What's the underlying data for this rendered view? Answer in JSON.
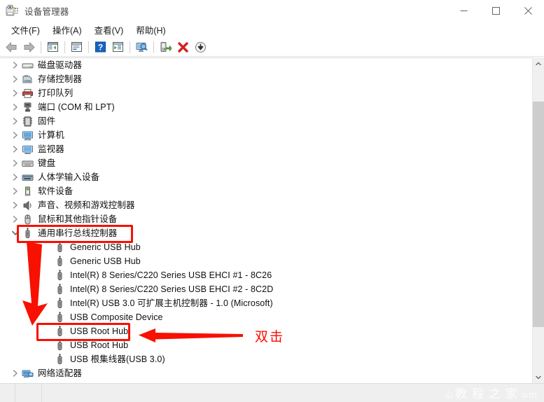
{
  "window": {
    "title": "设备管理器",
    "icon": "device-manager-icon",
    "controls": {
      "minimize": "最小化",
      "maximize": "最大化",
      "close": "关闭"
    }
  },
  "menubar": {
    "items": [
      {
        "label": "文件(F)",
        "name": "menu-file"
      },
      {
        "label": "操作(A)",
        "name": "menu-action"
      },
      {
        "label": "查看(V)",
        "name": "menu-view"
      },
      {
        "label": "帮助(H)",
        "name": "menu-help"
      }
    ]
  },
  "toolbar": {
    "buttons": [
      {
        "name": "back-button",
        "icon": "arrow-left-icon",
        "tooltip": "后退"
      },
      {
        "name": "forward-button",
        "icon": "arrow-right-icon",
        "tooltip": "前进"
      },
      {
        "name": "show-hide-console-tree-button",
        "icon": "console-tree-icon",
        "tooltip": "显示/隐藏控制台树"
      },
      {
        "name": "properties-button",
        "icon": "properties-icon",
        "tooltip": "属性"
      },
      {
        "name": "help-button",
        "icon": "help-question-icon",
        "tooltip": "帮助"
      },
      {
        "name": "update-driver-button",
        "icon": "update-driver-icon",
        "tooltip": "更新驱动程序"
      },
      {
        "name": "scan-hardware-changes-button",
        "icon": "scan-monitor-icon",
        "tooltip": "扫描检测硬件改动"
      },
      {
        "name": "enable-device-button",
        "icon": "enable-device-icon",
        "tooltip": "启用设备"
      },
      {
        "name": "uninstall-device-button",
        "icon": "red-x-icon",
        "tooltip": "卸载设备"
      },
      {
        "name": "disable-device-button",
        "icon": "disable-down-arrow-icon",
        "tooltip": "禁用设备"
      }
    ]
  },
  "tree": {
    "rows": [
      {
        "label": "磁盘驱动器",
        "level": 1,
        "expander": "collapsed",
        "icon": "disk-drive-icon",
        "name": "tree-item-disk-drives"
      },
      {
        "label": "存储控制器",
        "level": 1,
        "expander": "collapsed",
        "icon": "storage-controller-icon",
        "name": "tree-item-storage-controllers"
      },
      {
        "label": "打印队列",
        "level": 1,
        "expander": "collapsed",
        "icon": "printer-icon",
        "name": "tree-item-print-queues"
      },
      {
        "label": "端口 (COM 和 LPT)",
        "level": 1,
        "expander": "collapsed",
        "icon": "port-icon",
        "name": "tree-item-ports"
      },
      {
        "label": "固件",
        "level": 1,
        "expander": "collapsed",
        "icon": "firmware-chip-icon",
        "name": "tree-item-firmware"
      },
      {
        "label": "计算机",
        "level": 1,
        "expander": "collapsed",
        "icon": "computer-icon",
        "name": "tree-item-computer"
      },
      {
        "label": "监视器",
        "level": 1,
        "expander": "collapsed",
        "icon": "monitor-icon",
        "name": "tree-item-monitors"
      },
      {
        "label": "键盘",
        "level": 1,
        "expander": "collapsed",
        "icon": "keyboard-icon",
        "name": "tree-item-keyboards"
      },
      {
        "label": "人体学输入设备",
        "level": 1,
        "expander": "collapsed",
        "icon": "hid-icon",
        "name": "tree-item-hid"
      },
      {
        "label": "软件设备",
        "level": 1,
        "expander": "collapsed",
        "icon": "software-device-icon",
        "name": "tree-item-software-devices"
      },
      {
        "label": "声音、视频和游戏控制器",
        "level": 1,
        "expander": "collapsed",
        "icon": "speaker-icon",
        "name": "tree-item-sound-video-game"
      },
      {
        "label": "鼠标和其他指针设备",
        "level": 1,
        "expander": "collapsed",
        "icon": "mouse-icon",
        "name": "tree-item-mice"
      },
      {
        "label": "通用串行总线控制器",
        "level": 1,
        "expander": "expanded",
        "icon": "usb-icon",
        "name": "tree-item-usb-controllers",
        "highlighted": true
      },
      {
        "label": "Generic USB Hub",
        "level": 2,
        "expander": "none",
        "icon": "usb-device-icon",
        "name": "tree-item-generic-usb-hub-1"
      },
      {
        "label": "Generic USB Hub",
        "level": 2,
        "expander": "none",
        "icon": "usb-device-icon",
        "name": "tree-item-generic-usb-hub-2"
      },
      {
        "label": "Intel(R) 8 Series/C220 Series USB EHCI #1 - 8C26",
        "level": 2,
        "expander": "none",
        "icon": "usb-device-icon",
        "name": "tree-item-intel-ehci-1"
      },
      {
        "label": "Intel(R) 8 Series/C220 Series USB EHCI #2 - 8C2D",
        "level": 2,
        "expander": "none",
        "icon": "usb-device-icon",
        "name": "tree-item-intel-ehci-2"
      },
      {
        "label": "Intel(R) USB 3.0 可扩展主机控制器 - 1.0 (Microsoft)",
        "level": 2,
        "expander": "none",
        "icon": "usb-device-icon",
        "name": "tree-item-intel-usb3-host-controller"
      },
      {
        "label": "USB Composite Device",
        "level": 2,
        "expander": "none",
        "icon": "usb-device-icon",
        "name": "tree-item-usb-composite-device"
      },
      {
        "label": "USB Root Hub",
        "level": 2,
        "expander": "none",
        "icon": "usb-device-icon",
        "name": "tree-item-usb-root-hub-1",
        "highlighted": true
      },
      {
        "label": "USB Root Hub",
        "level": 2,
        "expander": "none",
        "icon": "usb-device-icon",
        "name": "tree-item-usb-root-hub-2"
      },
      {
        "label": "USB 根集线器(USB 3.0)",
        "level": 2,
        "expander": "none",
        "icon": "usb-device-icon",
        "name": "tree-item-usb-root-hub-3"
      },
      {
        "label": "网络适配器",
        "level": 1,
        "expander": "collapsed",
        "icon": "network-adapter-icon",
        "name": "tree-item-network-adapters"
      }
    ]
  },
  "annotations": {
    "color": "#f81000",
    "double_click_label": "双击",
    "arrows": [
      {
        "name": "annotation-arrow-diagonal",
        "direction": "down-right"
      },
      {
        "name": "annotation-arrow-left",
        "direction": "left"
      }
    ],
    "boxes": [
      {
        "name": "annotation-box-usb-controllers",
        "target": "通用串行总线控制器"
      },
      {
        "name": "annotation-box-usb-root-hub",
        "target": "USB Root Hub"
      }
    ]
  },
  "statusbar": {
    "text": ""
  },
  "watermark": {
    "text": "教程之家",
    "prefix": "心",
    "suffix": "om"
  }
}
